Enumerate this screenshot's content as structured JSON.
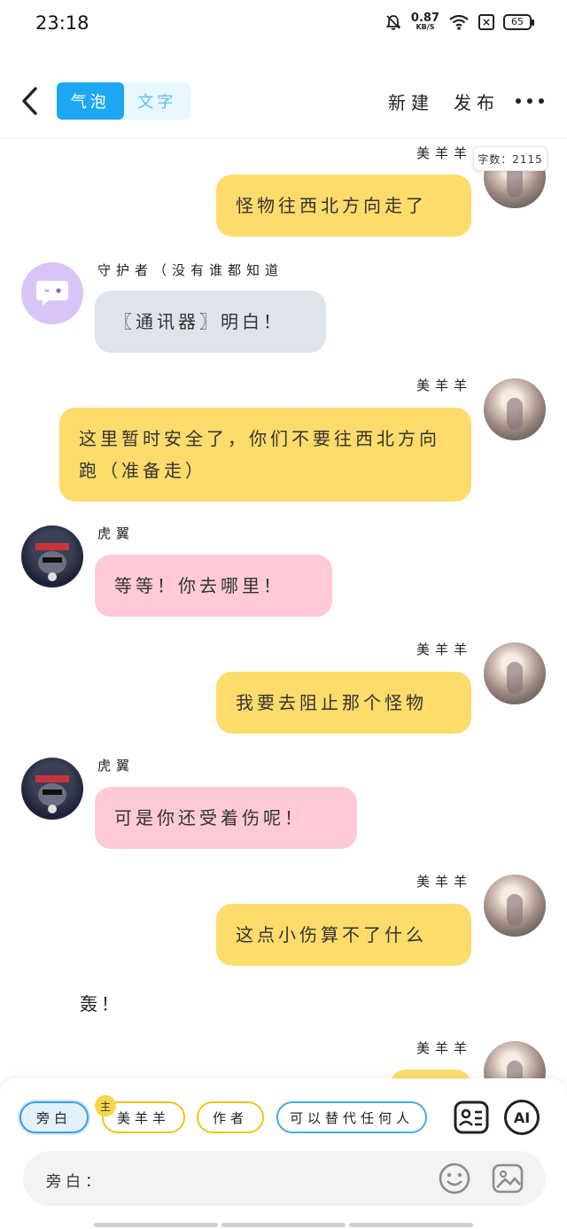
{
  "status_bar": {
    "time": "23:18",
    "net_speed_value": "0.87",
    "net_speed_unit": "KB/S",
    "battery": "65",
    "icons": [
      "bell-mute-icon",
      "wifi-icon",
      "x-box-icon",
      "battery-icon"
    ]
  },
  "header": {
    "back_icon": "chevron-left-icon",
    "modes": [
      "气泡",
      "文字"
    ],
    "active_mode": "气泡",
    "new_label": "新建",
    "publish_label": "发布",
    "more_icon": "more-dots-icon"
  },
  "word_count": "字数：2115",
  "messages": [
    {
      "side": "right",
      "name": "美羊羊",
      "text": "怪物往西北方向走了",
      "color": "yellow"
    },
    {
      "side": "left",
      "name": "守护者（没有谁都知道",
      "text": "〖通讯器〗明白！",
      "color": "gray"
    },
    {
      "side": "right",
      "name": "美羊羊",
      "text": "这里暂时安全了，你们不要往西北方向跑（准备走）",
      "color": "yellow"
    },
    {
      "side": "left",
      "name": "虎翼",
      "text": "等等！你去哪里！",
      "color": "pink"
    },
    {
      "side": "right",
      "name": "美羊羊",
      "text": "我要去阻止那个怪物",
      "color": "yellow"
    },
    {
      "side": "left",
      "name": "虎翼",
      "text": "可是你还受着伤呢！",
      "color": "pink"
    },
    {
      "side": "right",
      "name": "美羊羊",
      "text": "这点小伤算不了什么",
      "color": "yellow"
    },
    {
      "side": "right",
      "name": "美羊羊",
      "text": "",
      "color": "yellow"
    }
  ],
  "narration": "轰！",
  "colors": {
    "accent": "#1da7f3",
    "bubble_yellow": "#fddc6b",
    "bubble_gray": "#dfe4ec",
    "bubble_pink": "#fdcad6",
    "guard_avatar": "#d9c4f7"
  },
  "bottom": {
    "role_chips": [
      "旁白",
      "美羊羊",
      "作者",
      "可以替代任何人"
    ],
    "selected_role": "旁白",
    "host_badge": "主",
    "ai_label": "AI",
    "input_label": "旁白：",
    "icons": [
      "contact-card-icon",
      "ai-icon",
      "emoji-icon",
      "image-icon"
    ]
  }
}
